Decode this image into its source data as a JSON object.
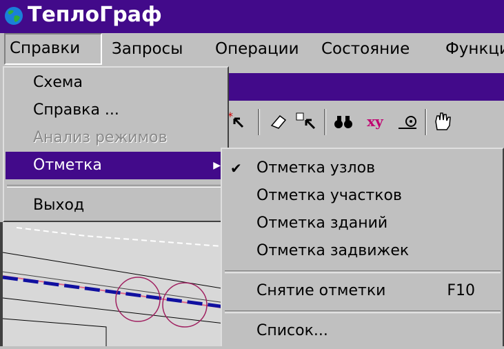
{
  "app": {
    "title": "ТеплоГраф",
    "icon": "globe-icon"
  },
  "menubar": {
    "spravki": "Справки",
    "zaprosy": "Запросы",
    "operacii": "Операции",
    "sostoyanie": "Состояние",
    "funkcii": "Функци"
  },
  "spravki_menu": {
    "schema": "Схема",
    "spravka": "Справка ...",
    "analiz": "Анализ режимов",
    "otmetka": "Отметка",
    "vyhod": "Выход"
  },
  "otmetka_menu": {
    "uzlov": "Отметка узлов",
    "uchastkov": "Отметка участков",
    "zdaniy": "Отметка зданий",
    "zadvizhek": "Отметка задвижек",
    "snyatie": "Снятие отметки",
    "snyatie_shortcut": "F10",
    "spisok": "Список..."
  },
  "toolbar": {
    "xy_label": "xy"
  },
  "colors": {
    "titlebar": "#420a8a",
    "menu_bg": "#c0c0c0",
    "highlight": "#420a8a"
  }
}
